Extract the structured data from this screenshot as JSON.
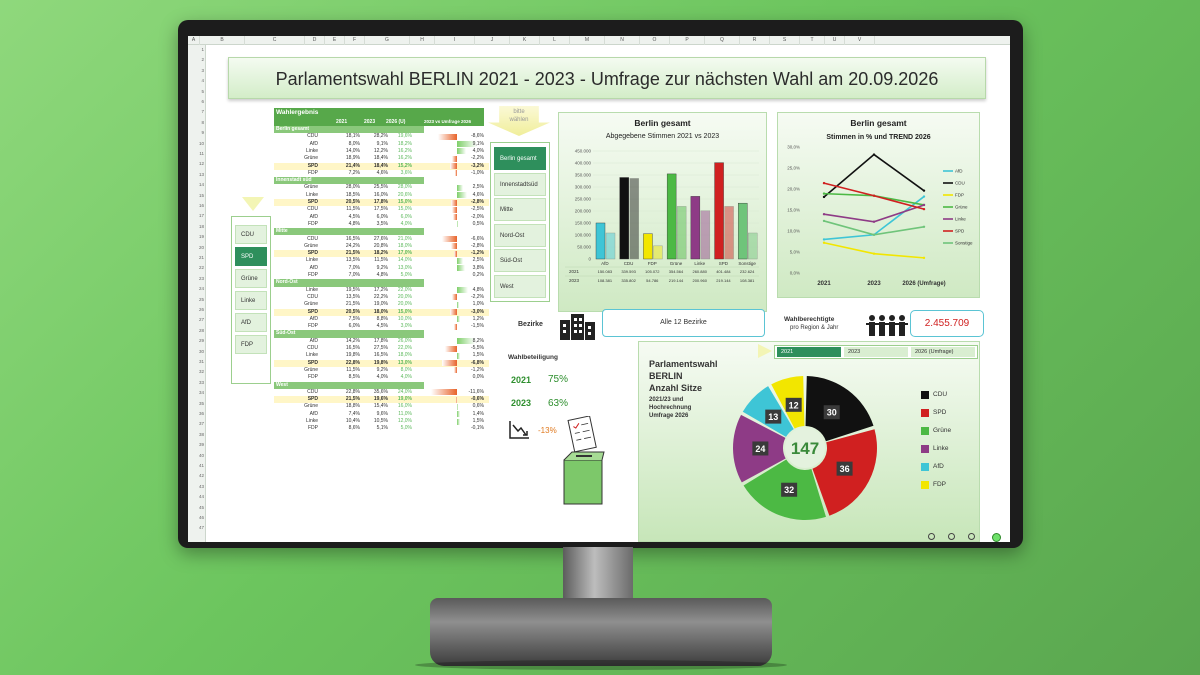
{
  "columns": [
    "A",
    "B",
    "C",
    "D",
    "E",
    "F",
    "G",
    "H",
    "I",
    "J",
    "K",
    "L",
    "M",
    "N",
    "O",
    "P",
    "Q",
    "R",
    "S",
    "T",
    "U",
    "V"
  ],
  "rows": [
    "1",
    "2",
    "3",
    "4",
    "5",
    "6",
    "7",
    "8",
    "9",
    "10",
    "11",
    "12",
    "13",
    "14",
    "15",
    "16",
    "17",
    "18",
    "19",
    "20",
    "21",
    "22",
    "23",
    "24",
    "25",
    "26",
    "27",
    "28",
    "29",
    "30",
    "31",
    "32",
    "33",
    "34",
    "35",
    "36",
    "37",
    "38",
    "39",
    "40",
    "41",
    "42",
    "43",
    "44",
    "45",
    "46",
    "47"
  ],
  "title": "Parlamentswahl BERLIN 2021 - 2023 - Umfrage zur nächsten Wahl am 20.09.2026",
  "table": {
    "header": "Wahlergebnis",
    "col_2021": "2021",
    "col_2023": "2023",
    "col_2026": "2026 (U)",
    "col_diff": "2023 vs Umfrage 2026",
    "sections": [
      {
        "name": "Berlin gesamt",
        "rows": [
          {
            "party": "CDU",
            "a": "18,1%",
            "b": "28,2%",
            "c": "19,6%",
            "d": "-8,6%",
            "v": -8.6
          },
          {
            "party": "AfD",
            "a": "8,0%",
            "b": "9,1%",
            "c": "18,2%",
            "d": "9,1%",
            "v": 9.1
          },
          {
            "party": "Linke",
            "a": "14,0%",
            "b": "12,2%",
            "c": "16,2%",
            "d": "4,0%",
            "v": 4.0
          },
          {
            "party": "Grüne",
            "a": "18,9%",
            "b": "18,4%",
            "c": "16,2%",
            "d": "-2,2%",
            "v": -2.2
          },
          {
            "party": "SPD",
            "a": "21,4%",
            "b": "18,4%",
            "c": "15,2%",
            "d": "-3,2%",
            "v": -3.2,
            "spd": true
          },
          {
            "party": "FDP",
            "a": "7,2%",
            "b": "4,6%",
            "c": "3,6%",
            "d": "-1,0%",
            "v": -1.0
          }
        ]
      },
      {
        "name": "Innenstadt süd",
        "rows": [
          {
            "party": "Grüne",
            "a": "28,0%",
            "b": "25,5%",
            "c": "28,0%",
            "d": "2,5%",
            "v": 2.5
          },
          {
            "party": "Linke",
            "a": "18,5%",
            "b": "16,0%",
            "c": "20,6%",
            "d": "4,6%",
            "v": 4.6
          },
          {
            "party": "SPD",
            "a": "20,5%",
            "b": "17,8%",
            "c": "15,0%",
            "d": "-2,8%",
            "v": -2.8,
            "spd": true
          },
          {
            "party": "CDU",
            "a": "11,5%",
            "b": "17,5%",
            "c": "15,0%",
            "d": "-2,5%",
            "v": -2.5
          },
          {
            "party": "AfD",
            "a": "4,5%",
            "b": "6,0%",
            "c": "6,0%",
            "d": "-2,0%",
            "v": -2.0
          },
          {
            "party": "FDP",
            "a": "4,8%",
            "b": "3,5%",
            "c": "4,0%",
            "d": "0,5%",
            "v": 0.5
          }
        ]
      },
      {
        "name": "Mitte",
        "rows": [
          {
            "party": "CDU",
            "a": "16,5%",
            "b": "27,6%",
            "c": "21,0%",
            "d": "-6,6%",
            "v": -6.6
          },
          {
            "party": "Grüne",
            "a": "24,2%",
            "b": "20,8%",
            "c": "18,0%",
            "d": "-2,8%",
            "v": -2.8
          },
          {
            "party": "SPD",
            "a": "21,5%",
            "b": "18,2%",
            "c": "17,0%",
            "d": "-1,2%",
            "v": -1.2,
            "spd": true
          },
          {
            "party": "Linke",
            "a": "13,5%",
            "b": "11,5%",
            "c": "14,0%",
            "d": "2,5%",
            "v": 2.5
          },
          {
            "party": "AfD",
            "a": "7,0%",
            "b": "9,2%",
            "c": "13,0%",
            "d": "3,8%",
            "v": 3.8
          },
          {
            "party": "FDP",
            "a": "7,0%",
            "b": "4,8%",
            "c": "5,0%",
            "d": "0,2%",
            "v": 0.2
          }
        ]
      },
      {
        "name": "Nord-Ost",
        "rows": [
          {
            "party": "Linke",
            "a": "19,5%",
            "b": "17,2%",
            "c": "22,0%",
            "d": "4,8%",
            "v": 4.8
          },
          {
            "party": "CDU",
            "a": "13,5%",
            "b": "22,2%",
            "c": "20,0%",
            "d": "-2,2%",
            "v": -2.2
          },
          {
            "party": "Grüne",
            "a": "21,5%",
            "b": "19,0%",
            "c": "20,0%",
            "d": "1,0%",
            "v": 1.0
          },
          {
            "party": "SPD",
            "a": "20,5%",
            "b": "18,0%",
            "c": "15,0%",
            "d": "-3,0%",
            "v": -3.0,
            "spd": true
          },
          {
            "party": "AfD",
            "a": "7,5%",
            "b": "8,8%",
            "c": "10,0%",
            "d": "1,2%",
            "v": 1.2
          },
          {
            "party": "FDP",
            "a": "6,0%",
            "b": "4,5%",
            "c": "3,0%",
            "d": "-1,5%",
            "v": -1.5
          }
        ]
      },
      {
        "name": "Süd-Ost",
        "rows": [
          {
            "party": "AfD",
            "a": "14,2%",
            "b": "17,8%",
            "c": "26,0%",
            "d": "8,2%",
            "v": 8.2
          },
          {
            "party": "CDU",
            "a": "16,5%",
            "b": "27,5%",
            "c": "22,0%",
            "d": "-5,5%",
            "v": -5.5
          },
          {
            "party": "Linke",
            "a": "19,8%",
            "b": "16,5%",
            "c": "18,0%",
            "d": "1,5%",
            "v": 1.5
          },
          {
            "party": "SPD",
            "a": "22,8%",
            "b": "19,8%",
            "c": "13,0%",
            "d": "-6,8%",
            "v": -6.8,
            "spd": true
          },
          {
            "party": "Grüne",
            "a": "11,5%",
            "b": "9,2%",
            "c": "8,0%",
            "d": "-1,2%",
            "v": -1.2
          },
          {
            "party": "FDP",
            "a": "8,5%",
            "b": "4,0%",
            "c": "4,0%",
            "d": "0,0%",
            "v": 0.0
          }
        ]
      },
      {
        "name": "West",
        "rows": [
          {
            "party": "CDU",
            "a": "22,8%",
            "b": "35,6%",
            "c": "24,0%",
            "d": "-11,6%",
            "v": -11.6
          },
          {
            "party": "SPD",
            "a": "21,5%",
            "b": "19,6%",
            "c": "19,0%",
            "d": "-0,6%",
            "v": -0.6,
            "spd": true
          },
          {
            "party": "Grüne",
            "a": "18,8%",
            "b": "15,4%",
            "c": "16,0%",
            "d": "0,6%",
            "v": 0.6
          },
          {
            "party": "AfD",
            "a": "7,4%",
            "b": "9,6%",
            "c": "11,0%",
            "d": "1,4%",
            "v": 1.4
          },
          {
            "party": "Linke",
            "a": "10,4%",
            "b": "10,5%",
            "c": "12,0%",
            "d": "1,5%",
            "v": 1.5
          },
          {
            "party": "FDP",
            "a": "8,6%",
            "b": "5,1%",
            "c": "5,0%",
            "d": "-0,1%",
            "v": -0.1
          }
        ]
      }
    ]
  },
  "party_slicer": {
    "items": [
      "CDU",
      "SPD",
      "Grüne",
      "Linke",
      "AfD",
      "FDP"
    ],
    "selected": "SPD"
  },
  "region_slicer": {
    "hint": "bitte wählen",
    "items": [
      "Berlin gesamt",
      "Innenstadtsüd",
      "Mitte",
      "Nord-Ost",
      "Süd-Ost",
      "West"
    ],
    "selected": "Berlin gesamt"
  },
  "colors": {
    "CDU": "#111111",
    "AfD": "#3ec5d6",
    "Linke": "#8e3b86",
    "Grüne": "#4cb944",
    "SPD": "#d02020",
    "FDP": "#f2e600",
    "Sonstige": "#6fc47a",
    "accent": "#2e8f5c"
  },
  "bar_chart": {
    "panel_title": "Berlin gesamt",
    "title": "Abgegebene Stimmen 2021 vs 2023",
    "y_ticks": [
      "0",
      "50.000",
      "100.000",
      "150.000",
      "200.000",
      "250.000",
      "300.000",
      "350.000",
      "400.000",
      "450.000"
    ],
    "table_rows": [
      {
        "label": "2021",
        "values": [
          "150.083",
          "339.593",
          "105.072",
          "354.564",
          "260.880",
          "401.484",
          "232.624"
        ]
      },
      {
        "label": "2023",
        "values": [
          "108.381",
          "335.802",
          "54.786",
          "219.144",
          "200.960",
          "219.144",
          "108.381"
        ]
      }
    ]
  },
  "chart_data": [
    {
      "type": "bar",
      "categories": [
        "AfD",
        "CDU",
        "FDP",
        "Grüne",
        "Linke",
        "SPD",
        "Sonstige"
      ],
      "series": [
        {
          "name": "2021",
          "values": [
            150083,
            339593,
            105072,
            354564,
            260880,
            401484,
            232624
          ]
        },
        {
          "name": "2023",
          "values": [
            108381,
            335802,
            54786,
            219144,
            200960,
            219144,
            108381
          ]
        }
      ],
      "title": "Abgegebene Stimmen 2021 vs 2023",
      "ylim": [
        0,
        450000
      ]
    },
    {
      "type": "line",
      "title": "Stimmen in % und TREND 2026",
      "categories": [
        "2021",
        "2023",
        "2026 (Umfrage)"
      ],
      "series": [
        {
          "name": "AfD",
          "values": [
            8.0,
            9.1,
            18.2
          ]
        },
        {
          "name": "CDU",
          "values": [
            18.1,
            28.2,
            19.6
          ]
        },
        {
          "name": "FDP",
          "values": [
            7.2,
            4.6,
            3.6
          ]
        },
        {
          "name": "Grüne",
          "values": [
            18.9,
            18.4,
            16.2
          ]
        },
        {
          "name": "Linke",
          "values": [
            14.0,
            12.2,
            16.2
          ]
        },
        {
          "name": "SPD",
          "values": [
            21.4,
            18.4,
            15.2
          ]
        },
        {
          "name": "Sonstige",
          "values": [
            12.4,
            9.1,
            11.0
          ]
        }
      ],
      "ylim": [
        0,
        30
      ],
      "y_ticks": [
        "0,0%",
        "5,0%",
        "10,0%",
        "15,0%",
        "20,0%",
        "25,0%",
        "30,0%"
      ]
    },
    {
      "type": "pie",
      "title": "Parlamentswahl BERLIN Anzahl Sitze",
      "categories": [
        "CDU",
        "SPD",
        "Grüne",
        "Linke",
        "AfD",
        "FDP"
      ],
      "values": [
        30,
        36,
        32,
        24,
        13,
        12
      ],
      "total": 147
    }
  ],
  "line_chart": {
    "panel_title": "Berlin gesamt"
  },
  "bezirke": {
    "label": "Bezirke",
    "value": "Alle 12 Bezirke"
  },
  "wahlberechtigte": {
    "label1": "Wahlberechtigte",
    "label2": "pro Region & Jahr",
    "value": "2.455.709"
  },
  "wahlbeteiligung": {
    "label": "Wahlbeteiligung",
    "y1": "2021",
    "v1": "75%",
    "y2": "2023",
    "v2": "63%",
    "diff": "-13%"
  },
  "seats": {
    "year_tabs": [
      "2021",
      "2023",
      "2026 (Umfrage)"
    ],
    "selected": "2021",
    "t1": "Parlamentswahl",
    "t2": "BERLIN",
    "t3": "Anzahl Sitze",
    "sub1": "2021/23 und",
    "sub2": "Hochrechnung",
    "sub3": "Umfrage 2026",
    "total": "147"
  }
}
